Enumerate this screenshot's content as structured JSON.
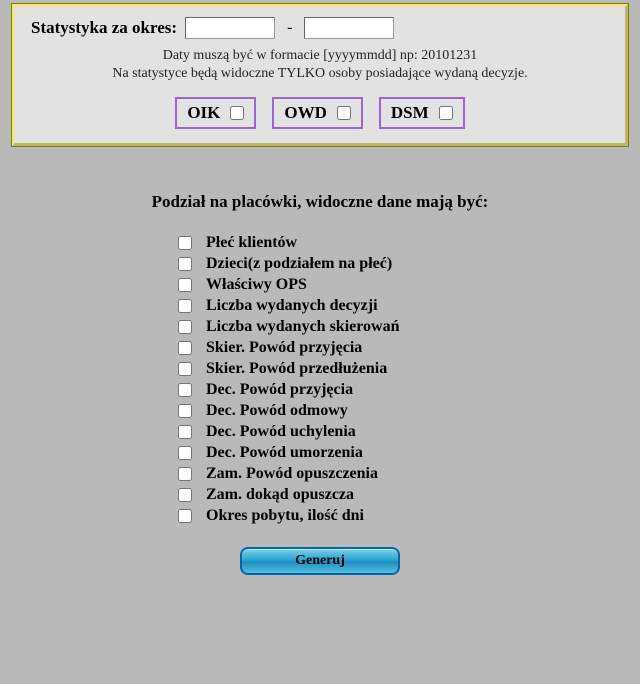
{
  "period": {
    "label": "Statystyka za okres:",
    "from": "",
    "to": "",
    "separator": "-",
    "hint_line1": "Daty muszą być w formacie [yyyymmdd] np: 20101231",
    "hint_line2": "Na statystyce będą widoczne TYLKO osoby posiadające wydaną decyzje."
  },
  "codes": [
    {
      "label": "OIK",
      "checked": false
    },
    {
      "label": "OWD",
      "checked": false
    },
    {
      "label": "DSM",
      "checked": false
    }
  ],
  "section_title": "Podział na placówki, widoczne dane mają być:",
  "options": [
    {
      "label": "Płeć klientów",
      "checked": false
    },
    {
      "label": "Dzieci(z podziałem na płeć)",
      "checked": false
    },
    {
      "label": "Właściwy OPS",
      "checked": false
    },
    {
      "label": "Liczba wydanych decyzji",
      "checked": false
    },
    {
      "label": "Liczba wydanych skierowań",
      "checked": false
    },
    {
      "label": "Skier. Powód przyjęcia",
      "checked": false
    },
    {
      "label": "Skier. Powód przedłużenia",
      "checked": false
    },
    {
      "label": "Dec. Powód przyjęcia",
      "checked": false
    },
    {
      "label": "Dec. Powód odmowy",
      "checked": false
    },
    {
      "label": "Dec. Powód uchylenia",
      "checked": false
    },
    {
      "label": "Dec. Powód umorzenia",
      "checked": false
    },
    {
      "label": "Zam. Powód opuszczenia",
      "checked": false
    },
    {
      "label": "Zam. dokąd opuszcza",
      "checked": false
    },
    {
      "label": "Okres pobytu, ilość dni",
      "checked": false
    }
  ],
  "generate_label": "Generuj"
}
